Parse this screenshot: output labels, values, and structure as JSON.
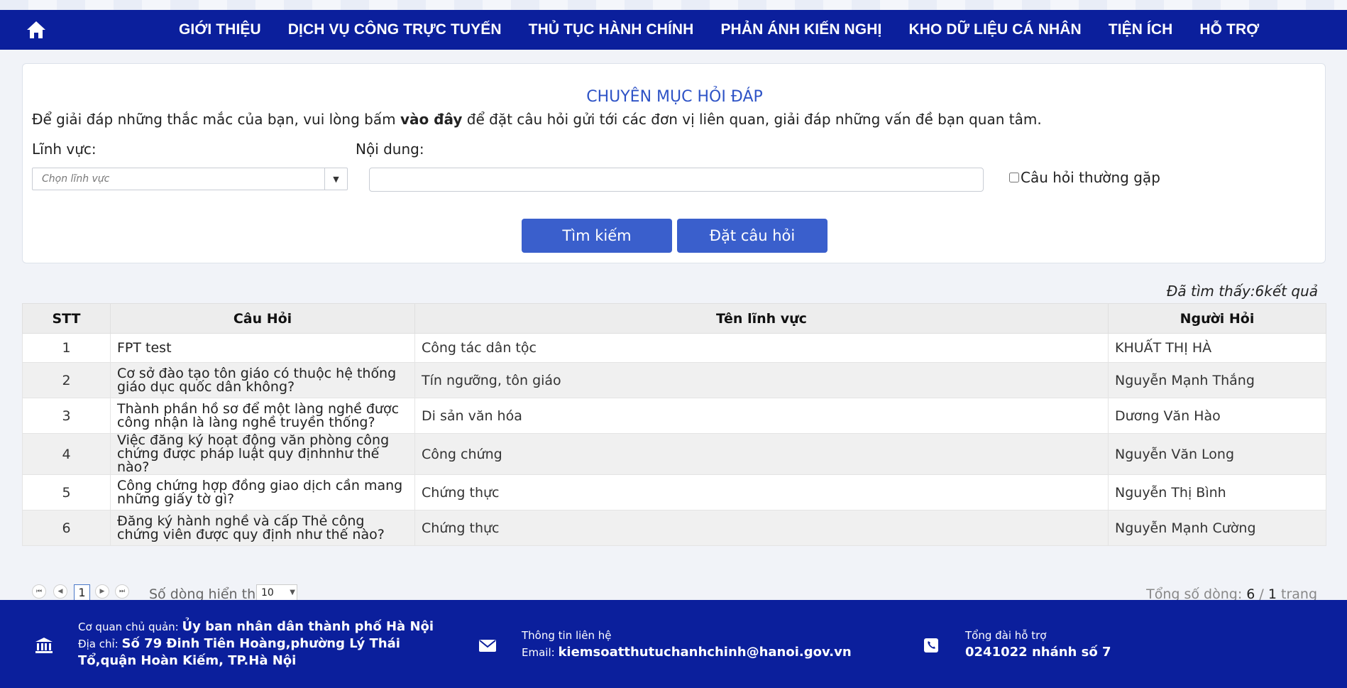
{
  "nav": {
    "items": [
      "GIỚI THIỆU",
      "DỊCH VỤ CÔNG TRỰC TUYẾN",
      "THỦ TỤC HÀNH CHÍNH",
      "PHẢN ÁNH KIẾN NGHỊ",
      "KHO DỮ LIỆU CÁ NHÂN",
      "TIỆN ÍCH",
      "HỖ TRỢ"
    ]
  },
  "search": {
    "title": "CHUYÊN MỤC HỎI ĐÁP",
    "intro_before": "Để giải đáp những thắc mắc của bạn, vui lòng bấm ",
    "intro_link": "vào đây",
    "intro_after": " để đặt câu hỏi gửi tới các đơn vị liên quan, giải đáp những vấn đề bạn quan tâm.",
    "field_label": "Lĩnh vực:",
    "field_placeholder": "Chọn lĩnh vực",
    "content_label": "Nội dung:",
    "content_value": "",
    "faq_label": "Câu hỏi thường gặp",
    "faq_checked": false,
    "search_button": "Tìm kiếm",
    "ask_button": "Đặt câu hỏi"
  },
  "results": {
    "count_text": "Đã tìm thấy:6kết quả",
    "columns": [
      "STT",
      "Câu Hỏi",
      "Tên lĩnh vực",
      "Người Hỏi"
    ],
    "rows": [
      {
        "stt": "1",
        "question": "FPT test",
        "field": "Công tác dân tộc",
        "asker": "KHUẤT THỊ HÀ"
      },
      {
        "stt": "2",
        "question": "Cơ sở đào tạo tôn giáo có thuộc hệ thống giáo dục quốc dân không?",
        "field": "Tín ngưỡng, tôn giáo",
        "asker": "Nguyễn Mạnh Thắng"
      },
      {
        "stt": "3",
        "question": "Thành phần hồ sơ để một làng nghề được công nhận là làng nghề truyền thống?",
        "field": "Di sản văn hóa",
        "asker": "Dương Văn Hào"
      },
      {
        "stt": "4",
        "question": "Việc đăng ký hoạt động văn phòng công chứng được pháp luật quy địnhnhư thế nào?",
        "field": "Công chứng",
        "asker": "Nguyễn Văn Long"
      },
      {
        "stt": "5",
        "question": "Công chứng hợp đồng giao dịch cần mang những giấy tờ gì?",
        "field": "Chứng thực",
        "asker": "Nguyễn Thị Bình"
      },
      {
        "stt": "6",
        "question": "Đăng ký hành nghề và cấp Thẻ công chứng viên được quy định như thế nào?",
        "field": "Chứng thực",
        "asker": "Nguyễn Mạnh Cường"
      }
    ]
  },
  "pager": {
    "current_page": "1",
    "rows_label": "Số dòng hiển thị",
    "rows_value": "10",
    "total_prefix": "Tổng số dòng: ",
    "total_rows": "6",
    "total_sep": " / ",
    "total_pages": "1",
    "total_suffix": " trang"
  },
  "footer": {
    "agency_label": "Cơ quan chủ quản: ",
    "agency_value": "Ủy ban nhân dân thành phố Hà Nội",
    "address_label": "Địa chỉ: ",
    "address_value": "Số 79 Đinh Tiên Hoàng,phường Lý Thái Tổ,quận Hoàn Kiếm, TP.Hà Nội",
    "contact_title": "Thông tin liên hệ",
    "email_label": "Email: ",
    "email_value": "kiemsoatthutuchanhchinh@hanoi.gov.vn",
    "hotline_title": "Tổng đài hỗ trợ",
    "hotline_value": "0241022 nhánh số 7"
  },
  "colors": {
    "navbar": "#0b1f9c",
    "accent_button": "#3a5fcc",
    "title_blue": "#2e53c6"
  }
}
